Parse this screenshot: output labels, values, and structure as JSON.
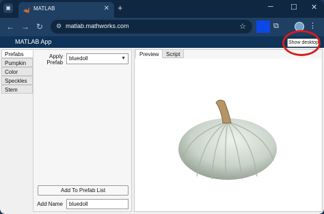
{
  "browser": {
    "tab_title": "MATLAB",
    "tab_close_icon": "close-icon",
    "new_tab_icon": "plus-icon",
    "address": "matlab.mathworks.com",
    "window_controls": [
      "minimize-icon",
      "maximize-icon",
      "close-icon"
    ]
  },
  "app": {
    "title": "MATLAB App",
    "show_desktop_label": "Show desktop",
    "accent": "#d51d1d"
  },
  "sidebar": {
    "tabs": [
      {
        "label": "Prefabs",
        "active": true
      },
      {
        "label": "Pumpkin",
        "active": false
      },
      {
        "label": "Color",
        "active": false
      },
      {
        "label": "Speckles",
        "active": false
      },
      {
        "label": "Stem",
        "active": false
      }
    ]
  },
  "prefabs": {
    "apply_label_line1": "Apply",
    "apply_label_line2": "Prefab",
    "selected_prefab": "bluedoll",
    "add_button_label": "Add To Prefab List",
    "add_name_label": "Add Name",
    "add_name_value": "bluedoll"
  },
  "viewer": {
    "tabs": [
      {
        "label": "Preview",
        "active": true
      },
      {
        "label": "Script",
        "active": false
      }
    ]
  }
}
